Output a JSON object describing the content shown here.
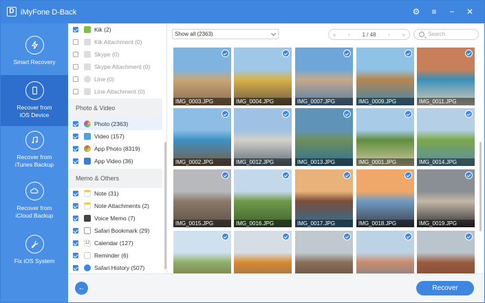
{
  "app": {
    "title": "iMyFone D-Back",
    "logo_letter": "D"
  },
  "window_controls": [
    "settings-icon",
    "menu-icon",
    "close-icon"
  ],
  "sidebar": {
    "items": [
      {
        "label": "Smart Recovery",
        "icon": "lightning-icon",
        "active": false
      },
      {
        "label": "Recover from iOS Device",
        "icon": "phone-icon",
        "active": true
      },
      {
        "label": "Recover from iTunes Backup",
        "icon": "music-note-icon",
        "active": false
      },
      {
        "label": "Recover from iCloud Backup",
        "icon": "cloud-icon",
        "active": false
      },
      {
        "label": "Fix iOS System",
        "icon": "wrench-icon",
        "active": false
      }
    ]
  },
  "categories": {
    "group1": [
      {
        "label": "Kik (2)",
        "checked": true,
        "icon_color": "#7ac142"
      },
      {
        "label": "Kik Attachment (0)",
        "checked": false,
        "icon_color": "#cccccc"
      },
      {
        "label": "Skype (0)",
        "checked": false,
        "icon_color": "#cccccc"
      },
      {
        "label": "Skype Attachment (0)",
        "checked": false,
        "icon_color": "#cccccc"
      },
      {
        "label": "Line (0)",
        "checked": false,
        "icon_color": "#cccccc"
      },
      {
        "label": "Line Attachment (0)",
        "checked": false,
        "icon_color": "#cccccc"
      }
    ],
    "photo_video_header": "Photo & Video",
    "photo_video": [
      {
        "label": "Photo (2363)",
        "checked": true,
        "icon_color": "#e8a13a",
        "selected": true
      },
      {
        "label": "Video (157)",
        "checked": true,
        "icon_color": "#4aa3df"
      },
      {
        "label": "App Photo (8319)",
        "checked": true,
        "icon_color": "#e4574b"
      },
      {
        "label": "App Video (36)",
        "checked": true,
        "icon_color": "#3b7dd8"
      }
    ],
    "memo_header": "Memo & Others",
    "memo": [
      {
        "label": "Note (31)",
        "checked": true,
        "icon_color": "#f2c94c"
      },
      {
        "label": "Note Attachments (2)",
        "checked": true,
        "icon_color": "#f2c94c"
      },
      {
        "label": "Voice Memo (7)",
        "checked": true,
        "icon_color": "#555555"
      },
      {
        "label": "Safari Bookmark (29)",
        "checked": true,
        "icon_color": "#7a7a7a"
      },
      {
        "label": "Calendar (127)",
        "checked": true,
        "icon_color": "#e8e8e8"
      },
      {
        "label": "Reminder (6)",
        "checked": true,
        "icon_color": "#e8e8e8"
      },
      {
        "label": "Safari History (507)",
        "checked": true,
        "icon_color": "#3f86e0"
      }
    ]
  },
  "toolbar": {
    "filter_value": "Show all (2363)",
    "page_indicator": "1 / 48",
    "search_placeholder": "Search"
  },
  "photos": [
    {
      "name": "IMG_0003.JPG",
      "colors": [
        "#7fb3e0",
        "#c9a77a",
        "#8a6b4e"
      ]
    },
    {
      "name": "IMG_0004.JPG",
      "colors": [
        "#9fc7e8",
        "#d8b24a",
        "#6e5a44"
      ]
    },
    {
      "name": "IMG_0007.JPG",
      "colors": [
        "#6fa6d9",
        "#c7a98a",
        "#4f7fa8"
      ]
    },
    {
      "name": "IMG_0009.JPG",
      "colors": [
        "#8fc3e6",
        "#b7864f",
        "#3e86b0"
      ]
    },
    {
      "name": "IMG_0011.JPG",
      "colors": [
        "#c9805a",
        "#3a8fb8",
        "#d9ccb8"
      ]
    },
    {
      "name": "IMG_0002.JPG",
      "colors": [
        "#8dbde4",
        "#3f91c4",
        "#7a5a3e"
      ]
    },
    {
      "name": "IMG_0012.JPG",
      "colors": [
        "#9fc1e3",
        "#d4d0c8",
        "#5c6e7a"
      ]
    },
    {
      "name": "IMG_0013.JPG",
      "colors": [
        "#5f93b8",
        "#6e8f5a",
        "#2f6f9a"
      ]
    },
    {
      "name": "IMG_0001.JPG",
      "colors": [
        "#a8cbe8",
        "#5f8f3e",
        "#d0c8a0"
      ]
    },
    {
      "name": "IMG_0014.JPG",
      "colors": [
        "#b5cfe6",
        "#7aa84a",
        "#5b8db0"
      ]
    },
    {
      "name": "IMG_0015.JPG",
      "colors": [
        "#b7b9bd",
        "#8a7a6a",
        "#5a5048"
      ]
    },
    {
      "name": "IMG_0016.JPG",
      "colors": [
        "#c3d8ea",
        "#6f9a4a",
        "#3e5f2e"
      ]
    },
    {
      "name": "IMG_0017.JPG",
      "colors": [
        "#e8b27a",
        "#7a4e3a",
        "#2e6f9a"
      ]
    },
    {
      "name": "IMG_0018.JPG",
      "colors": [
        "#f0a86a",
        "#6f9ac0",
        "#3a3f4a"
      ]
    },
    {
      "name": "IMG_0019.JPG",
      "colors": [
        "#8a8f95",
        "#c4b8a8",
        "#2f2f34"
      ]
    },
    {
      "name": "",
      "colors": [
        "#cfe0ee",
        "#8fae6a",
        "#6a5a3e"
      ]
    },
    {
      "name": "",
      "colors": [
        "#d6dde4",
        "#d8892e",
        "#6a6a6a"
      ]
    },
    {
      "name": "",
      "colors": [
        "#c0c8d0",
        "#8a6f58",
        "#4a4038"
      ]
    },
    {
      "name": "",
      "colors": [
        "#bcd3e6",
        "#c98a6a",
        "#4f7fa8"
      ]
    },
    {
      "name": "",
      "colors": [
        "#b9c4cc",
        "#9a5a3e",
        "#6a4e3a"
      ]
    }
  ],
  "footer": {
    "recover_label": "Recover",
    "back_icon": "arrow-left-icon"
  }
}
